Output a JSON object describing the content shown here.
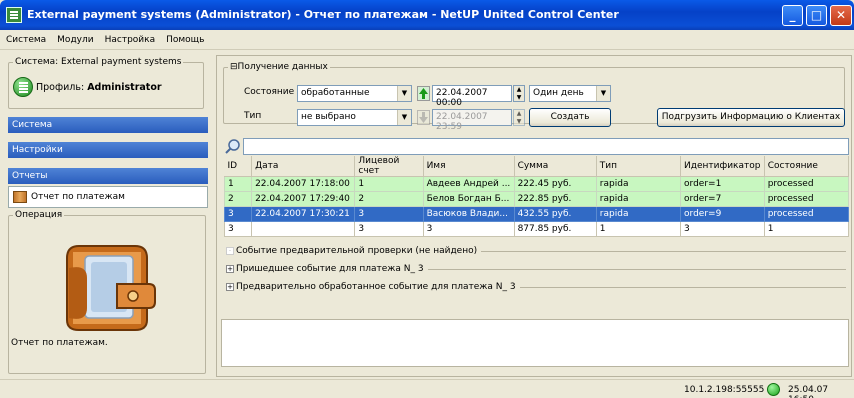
{
  "window": {
    "title": "External payment systems (Administrator) - Отчет по платежам - NetUP United Control Center"
  },
  "menu": [
    "Система",
    "Модули",
    "Настройка",
    "Помощь"
  ],
  "left": {
    "system_legend": "Система: External payment systems",
    "profile_label": "Профиль:",
    "profile_name": "Administrator",
    "nav_system": "Система",
    "nav_settings": "Настройки",
    "nav_reports": "Отчеты",
    "report_item": "Отчет по платежам",
    "operation_legend": "Операция",
    "operation_text": "Отчет по платежам."
  },
  "data_group": {
    "legend": "Получение данных",
    "state_label": "Состояние",
    "state_value": "обработанные",
    "date_from": "22.04.2007 00:00",
    "period_value": "Один день",
    "type_label": "Тип",
    "type_value": "не выбрано",
    "date_to": "22.04.2007 23:59",
    "create_button": "Создать",
    "load_button": "Подгрузить Информацию о Клиентах"
  },
  "table": {
    "headers": [
      "ID",
      "Дата",
      "Лицевой счет",
      "Имя",
      "Сумма",
      "Тип",
      "Идентификатор",
      "Состояние"
    ],
    "rows": [
      [
        "1",
        "22.04.2007 17:18:00",
        "1",
        "Авдеев Андрей ...",
        "222.45 руб.",
        "rapida",
        "order=1",
        "processed"
      ],
      [
        "2",
        "22.04.2007 17:29:40",
        "2",
        "Белов Богдан Б...",
        "222.85 руб.",
        "rapida",
        "order=7",
        "processed"
      ],
      [
        "3",
        "22.04.2007 17:30:21",
        "3",
        "Васюков Влади...",
        "432.55 руб.",
        "rapida",
        "order=9",
        "processed"
      ]
    ],
    "totals": [
      "3",
      "",
      "3",
      "3",
      "877.85 руб.",
      "1",
      "3",
      "1"
    ]
  },
  "sections": [
    "Событие предварительной проверки (не найдено)",
    "Пришедшее событие для платежа N_ 3",
    "Предварительно обработанное событие для платежа N_ 3"
  ],
  "status": {
    "address": "10.1.2.198:55555",
    "datetime": "25.04.07 16:50"
  },
  "colors": {
    "titlebar": "#0a5ae8",
    "selected_row": "#316ac5",
    "processed_row": "#c8f7c0",
    "nav": "#2a5dbd"
  }
}
